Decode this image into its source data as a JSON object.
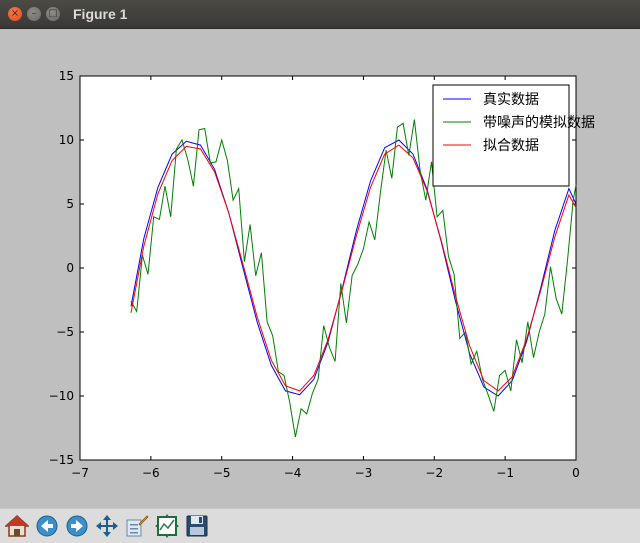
{
  "window": {
    "title": "Figure 1"
  },
  "toolbar": {
    "buttons": [
      {
        "name": "home-icon"
      },
      {
        "name": "back-icon"
      },
      {
        "name": "forward-icon"
      },
      {
        "name": "pan-icon"
      },
      {
        "name": "zoom-icon"
      },
      {
        "name": "subplots-icon"
      },
      {
        "name": "save-icon"
      }
    ]
  },
  "chart_data": {
    "type": "line",
    "xlim": [
      -7,
      0
    ],
    "ylim": [
      -15,
      15
    ],
    "xticks": [
      -7,
      -6,
      -5,
      -4,
      -3,
      -2,
      -1,
      0
    ],
    "yticks": [
      -15,
      -10,
      -5,
      0,
      5,
      10,
      15
    ],
    "xtick_labels": [
      "−7",
      "−6",
      "−5",
      "−4",
      "−3",
      "−2",
      "−1",
      "0"
    ],
    "ytick_labels": [
      "−15",
      "−10",
      "−5",
      "0",
      "5",
      "10",
      "15"
    ],
    "legend_position": "top-right",
    "series": [
      {
        "name": "真实数据",
        "color": "#0000ff",
        "x": [
          -6.28,
          -6.1,
          -5.9,
          -5.7,
          -5.5,
          -5.3,
          -5.1,
          -4.9,
          -4.7,
          -4.5,
          -4.3,
          -4.1,
          -3.9,
          -3.7,
          -3.5,
          -3.3,
          -3.1,
          -2.9,
          -2.7,
          -2.5,
          -2.3,
          -2.1,
          -1.9,
          -1.7,
          -1.5,
          -1.3,
          -1.1,
          -0.9,
          -0.7,
          -0.5,
          -0.3,
          -0.1,
          0.0
        ],
        "y": [
          -3.0,
          2.3,
          6.3,
          8.9,
          9.9,
          9.6,
          7.7,
          4.3,
          0.0,
          -4.2,
          -7.6,
          -9.6,
          -9.9,
          -8.7,
          -5.8,
          -1.6,
          2.9,
          6.8,
          9.4,
          10.0,
          8.9,
          6.1,
          2.0,
          -2.6,
          -6.7,
          -9.3,
          -10.0,
          -8.8,
          -5.8,
          -1.6,
          2.9,
          6.2,
          5.0
        ]
      },
      {
        "name": "带噪声的模拟数据",
        "color": "#008000",
        "x": [
          -6.28,
          -6.2,
          -6.12,
          -6.04,
          -5.96,
          -5.88,
          -5.8,
          -5.72,
          -5.64,
          -5.56,
          -5.48,
          -5.4,
          -5.32,
          -5.24,
          -5.16,
          -5.08,
          -5.0,
          -4.92,
          -4.84,
          -4.76,
          -4.68,
          -4.6,
          -4.52,
          -4.44,
          -4.36,
          -4.28,
          -4.2,
          -4.12,
          -4.04,
          -3.96,
          -3.88,
          -3.8,
          -3.72,
          -3.64,
          -3.56,
          -3.48,
          -3.4,
          -3.32,
          -3.24,
          -3.16,
          -3.08,
          -3.0,
          -2.92,
          -2.84,
          -2.76,
          -2.68,
          -2.6,
          -2.52,
          -2.44,
          -2.36,
          -2.28,
          -2.2,
          -2.12,
          -2.04,
          -1.96,
          -1.88,
          -1.8,
          -1.72,
          -1.64,
          -1.56,
          -1.48,
          -1.4,
          -1.32,
          -1.24,
          -1.16,
          -1.08,
          -1.0,
          -0.92,
          -0.84,
          -0.76,
          -0.68,
          -0.6,
          -0.52,
          -0.44,
          -0.36,
          -0.28,
          -0.2,
          -0.12,
          -0.04,
          0.0
        ],
        "y": [
          -2.6,
          -3.4,
          1.0,
          -0.5,
          4.0,
          3.8,
          6.4,
          4.0,
          9.3,
          10.0,
          8.5,
          6.4,
          10.8,
          10.9,
          8.2,
          8.3,
          10.0,
          8.4,
          5.3,
          6.2,
          0.5,
          3.4,
          -0.6,
          1.2,
          -4.2,
          -5.3,
          -8.1,
          -8.4,
          -10.5,
          -13.2,
          -11.0,
          -11.4,
          -9.8,
          -8.7,
          -4.5,
          -6.2,
          -7.3,
          -1.2,
          -4.3,
          -0.6,
          0.3,
          1.5,
          3.6,
          2.2,
          5.9,
          9.2,
          7.0,
          11.0,
          11.3,
          8.8,
          11.6,
          7.6,
          5.3,
          8.3,
          4.0,
          4.5,
          0.9,
          -0.5,
          -5.5,
          -5.0,
          -7.5,
          -6.5,
          -8.7,
          -9.9,
          -11.2,
          -8.4,
          -8.0,
          -9.6,
          -5.6,
          -7.4,
          -4.2,
          -7.0,
          -5.0,
          -3.6,
          0.1,
          -2.4,
          -3.6,
          0.6,
          5.3,
          6.5
        ]
      },
      {
        "name": "拟合数据",
        "color": "#ff0000",
        "x": [
          -6.28,
          -6.1,
          -5.9,
          -5.7,
          -5.5,
          -5.3,
          -5.1,
          -4.9,
          -4.7,
          -4.5,
          -4.3,
          -4.1,
          -3.9,
          -3.7,
          -3.5,
          -3.3,
          -3.1,
          -2.9,
          -2.7,
          -2.5,
          -2.3,
          -2.1,
          -1.9,
          -1.7,
          -1.5,
          -1.3,
          -1.1,
          -0.9,
          -0.7,
          -0.5,
          -0.3,
          -0.1,
          0.0
        ],
        "y": [
          -3.5,
          1.7,
          5.8,
          8.4,
          9.5,
          9.3,
          7.5,
          4.3,
          0.3,
          -3.8,
          -7.2,
          -9.2,
          -9.6,
          -8.4,
          -5.6,
          -1.7,
          2.5,
          6.3,
          8.9,
          9.6,
          8.6,
          6.0,
          2.1,
          -2.2,
          -6.1,
          -8.8,
          -9.6,
          -8.5,
          -5.6,
          -1.8,
          2.4,
          5.7,
          4.7
        ]
      }
    ]
  }
}
